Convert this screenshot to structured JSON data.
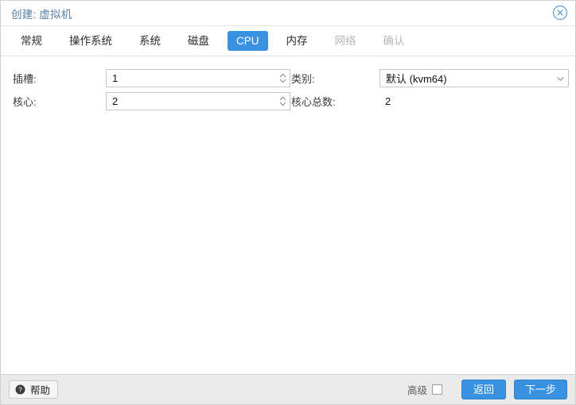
{
  "window": {
    "title_prefix": "创建:",
    "title_value": "虚拟机",
    "title_full": "创建: 虚拟机",
    "close_icon": "close-circle-icon",
    "accent_color": "#3892e0",
    "title_color": "#5a7fa6"
  },
  "tabs": [
    {
      "label": "常规",
      "state": "enabled"
    },
    {
      "label": "操作系统",
      "state": "enabled"
    },
    {
      "label": "系统",
      "state": "enabled"
    },
    {
      "label": "磁盘",
      "state": "enabled"
    },
    {
      "label": "CPU",
      "state": "active"
    },
    {
      "label": "内存",
      "state": "enabled"
    },
    {
      "label": "网络",
      "state": "disabled"
    },
    {
      "label": "确认",
      "state": "disabled"
    }
  ],
  "form": {
    "sockets": {
      "label": "插槽:",
      "value": "1",
      "spinner_icon": "spinner-up-down-icon"
    },
    "cores": {
      "label": "核心:",
      "value": "2",
      "spinner_icon": "spinner-up-down-icon"
    },
    "type": {
      "label": "类别:",
      "value": "默认 (kvm64)",
      "chevron_icon": "chevron-down-icon"
    },
    "total_cores": {
      "label": "核心总数:",
      "value": "2"
    }
  },
  "footer": {
    "help_label": "帮助",
    "help_icon": "question-mark-circle-icon",
    "advanced_label": "高级",
    "advanced_checked": false,
    "back_label": "返回",
    "next_label": "下一步"
  }
}
